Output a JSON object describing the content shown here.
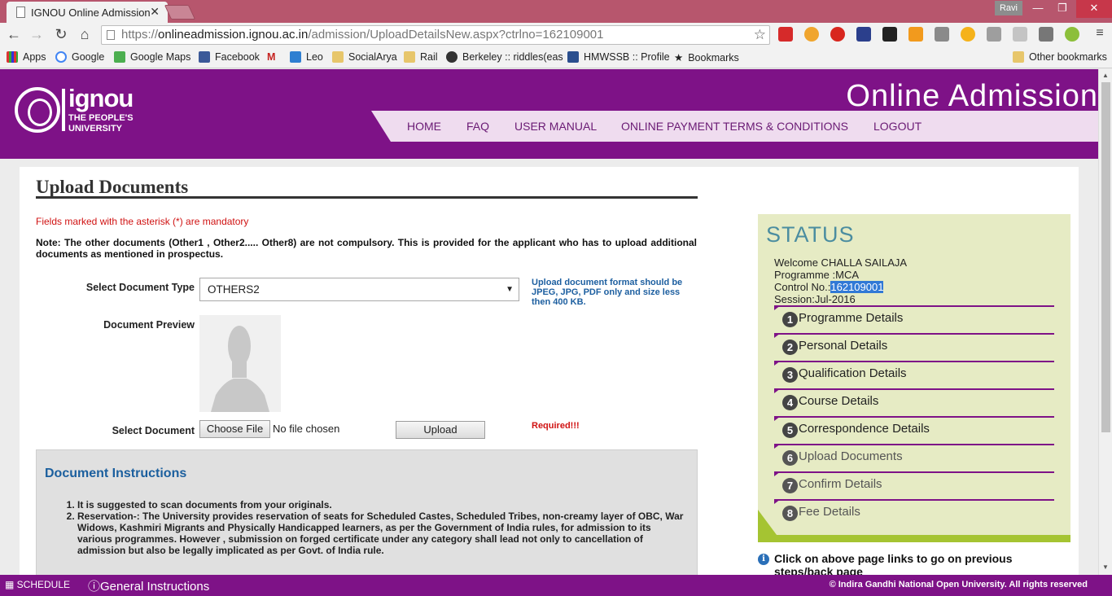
{
  "browser": {
    "tab_title": "IGNOU Online Admission",
    "user": "Ravi",
    "url_prefix": "https://",
    "url_host": "onlineadmission.ignou.ac.in",
    "url_path": "/admission/UploadDetailsNew.aspx?ctrlno=162109001",
    "bookmarks": [
      "Apps",
      "Google",
      "Google Maps",
      "Facebook",
      "M",
      "Leo",
      "SocialArya",
      "Rail",
      "Berkeley :: riddles(eas",
      "HMWSSB :: Profile",
      "Bookmarks"
    ],
    "other_bookmarks": "Other bookmarks"
  },
  "header": {
    "logo_word": "ignou",
    "logo_tag_1": "THE PEOPLE'S",
    "logo_tag_2": "UNIVERSITY",
    "title": "Online Admission",
    "menu": [
      "HOME",
      "FAQ",
      "USER MANUAL",
      "ONLINE PAYMENT TERMS & CONDITIONS",
      "LOGOUT"
    ]
  },
  "form": {
    "heading": "Upload Documents",
    "mandatory": "Fields marked with the asterisk (*) are mandatory",
    "note": "Note: The other documents (Other1 , Other2..... Other8) are not compulsory. This is provided for the applicant who has to upload additional documents as mentioned in prospectus.",
    "doc_type_label": "Select Document Type",
    "doc_type_value": "OTHERS2",
    "format_hint": "Upload document format should be JPEG, JPG, PDF only and size less then 400 KB.",
    "preview_label": "Document Preview",
    "select_doc_label": "Select Document",
    "choose_file": "Choose File",
    "no_file": "No file chosen",
    "upload": "Upload",
    "required": "Required!!!"
  },
  "instructions": {
    "heading": "Document Instructions",
    "items": [
      "It is suggested to scan documents from your originals.",
      "Reservation-: The University provides reservation of seats for Scheduled Castes, Scheduled Tribes, non-creamy layer of OBC, War Widows, Kashmiri Migrants and Physically Handicapped learners, as per the Government of India rules, for admission to its various programmes. However , submission on forged certificate under any category shall lead not only to cancellation of admission but also be legally implicated as per Govt. of India rule."
    ]
  },
  "status": {
    "title": "STATUS",
    "welcome": "Welcome CHALLA SAILAJA",
    "programme": "Programme :MCA",
    "control_label": "Control No.:",
    "control_no": "162109001",
    "session": "Session:Jul-2016",
    "steps": [
      {
        "num": "1",
        "label": "Programme Details"
      },
      {
        "num": "2",
        "label": "Personal Details"
      },
      {
        "num": "3",
        "label": "Qualification Details"
      },
      {
        "num": "4",
        "label": "Course Details"
      },
      {
        "num": "5",
        "label": "Correspondence Details"
      },
      {
        "num": "6",
        "label": "Upload Documents"
      },
      {
        "num": "7",
        "label": "Confirm Details"
      },
      {
        "num": "8",
        "label": "Fee Details"
      }
    ],
    "hint": "Click on above page links to go on previous steps/back page"
  },
  "footer": {
    "schedule": "SCHEDULE",
    "general": "General Instructions",
    "copyright": "© Indira Gandhi National Open University. All rights reserved"
  }
}
